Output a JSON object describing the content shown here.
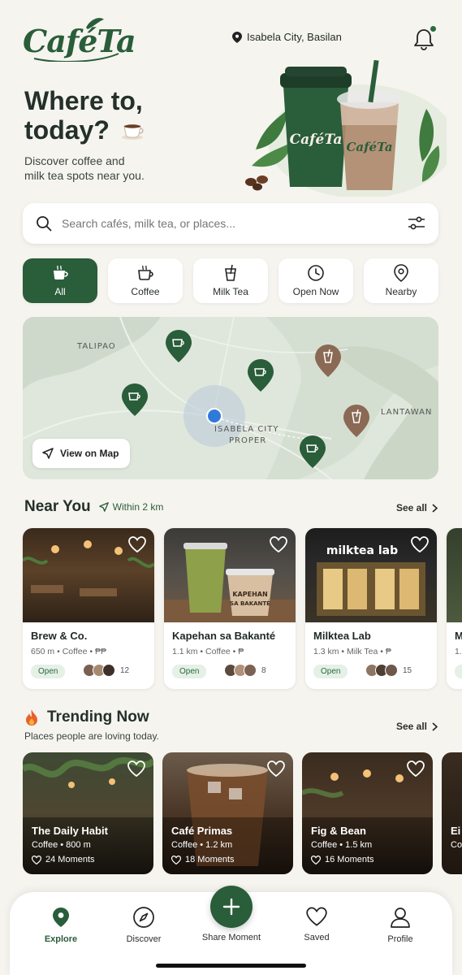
{
  "app": {
    "logo_text": "CaféTa"
  },
  "header": {
    "location": "Isabela City, Basilan"
  },
  "hero": {
    "title_line1": "Where to,",
    "title_line2": "today?",
    "subtitle_line1": "Discover coffee and",
    "subtitle_line2": "milk tea spots near you.",
    "cup_label": "CaféTa"
  },
  "search": {
    "placeholder": "Search cafés, milk tea, or places..."
  },
  "filters": [
    {
      "label": "All",
      "icon": "coffee-cup-icon",
      "active": true
    },
    {
      "label": "Coffee",
      "icon": "coffee-mug-icon"
    },
    {
      "label": "Milk Tea",
      "icon": "milk-tea-cup-icon"
    },
    {
      "label": "Open Now",
      "icon": "clock-icon"
    },
    {
      "label": "Nearby",
      "icon": "location-pin-icon"
    }
  ],
  "map": {
    "labels": [
      "TALIPAO",
      "LANTAWAN",
      "ISABELA CITY",
      "PROPER"
    ],
    "view_button": "View on Map"
  },
  "near_you": {
    "title": "Near You",
    "radius": "Within 2 km",
    "see_all": "See all",
    "cards": [
      {
        "name": "Brew & Co.",
        "meta": "650 m  •  Coffee  •  ₱₱",
        "status": "Open",
        "count": "12"
      },
      {
        "name": "Kapehan sa Bakanté",
        "meta": "1.1 km  •  Coffee  •  ₱",
        "status": "Open",
        "count": "8",
        "cup_text_1": "KAPEHAN",
        "cup_text_2": "SA BAKANTÉ"
      },
      {
        "name": "Milktea Lab",
        "meta": "1.3 km  •  Milk Tea  •  ₱",
        "status": "Open",
        "count": "15",
        "sign": "milktea lab"
      },
      {
        "name": "M",
        "meta": "1.",
        "status": "O"
      }
    ]
  },
  "trending": {
    "title": "Trending Now",
    "subtitle": "Places people are loving today.",
    "see_all": "See all",
    "cards": [
      {
        "name": "The Daily Habit",
        "meta": "Coffee  •  800 m",
        "moments": "24 Moments"
      },
      {
        "name": "Café Primas",
        "meta": "Coffee  •  1.2 km",
        "moments": "18 Moments"
      },
      {
        "name": "Fig & Bean",
        "meta": "Coffee  •  1.5 km",
        "moments": "16 Moments"
      },
      {
        "name": "Ei",
        "meta": "Co",
        "moments": ""
      }
    ]
  },
  "nav": {
    "explore": "Explore",
    "discover": "Discover",
    "share": "Share Moment",
    "saved": "Saved",
    "profile": "Profile"
  },
  "colors": {
    "brand": "#2a5d3a",
    "accent_brown": "#8a6a55",
    "background": "#f6f4ef"
  }
}
